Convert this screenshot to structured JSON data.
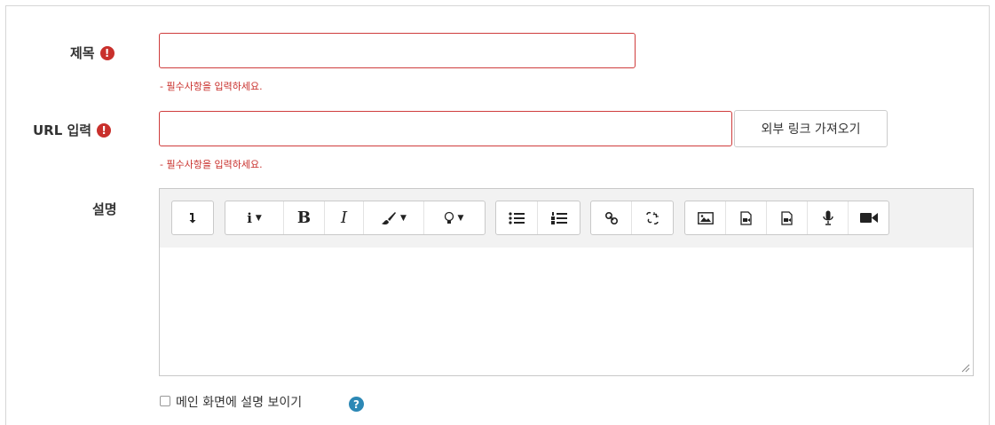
{
  "form": {
    "title_field": {
      "label": "제목",
      "value": "",
      "error": "- 필수사항을 입력하세요."
    },
    "url_field": {
      "label": "URL 입력",
      "value": "",
      "error": "- 필수사항을 입력하세요.",
      "fetch_button": "외부 링크 가져오기"
    },
    "description": {
      "label": "설명",
      "content": ""
    },
    "show_on_main": {
      "label": "메인 화면에 설명 보이기",
      "checked": false
    },
    "required_icon": "!",
    "help_icon": "?"
  },
  "toolbar": {
    "groups": [
      [
        "collapse-icon"
      ],
      [
        "info-icon",
        "bold-icon",
        "italic-icon",
        "brush-icon",
        "lightbulb-icon"
      ],
      [
        "unordered-list-icon",
        "ordered-list-icon"
      ],
      [
        "link-icon",
        "unlink-icon"
      ],
      [
        "image-icon",
        "media-icon",
        "file-icon",
        "microphone-icon",
        "video-icon"
      ]
    ],
    "bold_label": "B",
    "italic_label": "I",
    "info_label": "i"
  },
  "colors": {
    "error": "#c9302c",
    "help": "#2c88b5",
    "border": "#c8c8c8"
  }
}
